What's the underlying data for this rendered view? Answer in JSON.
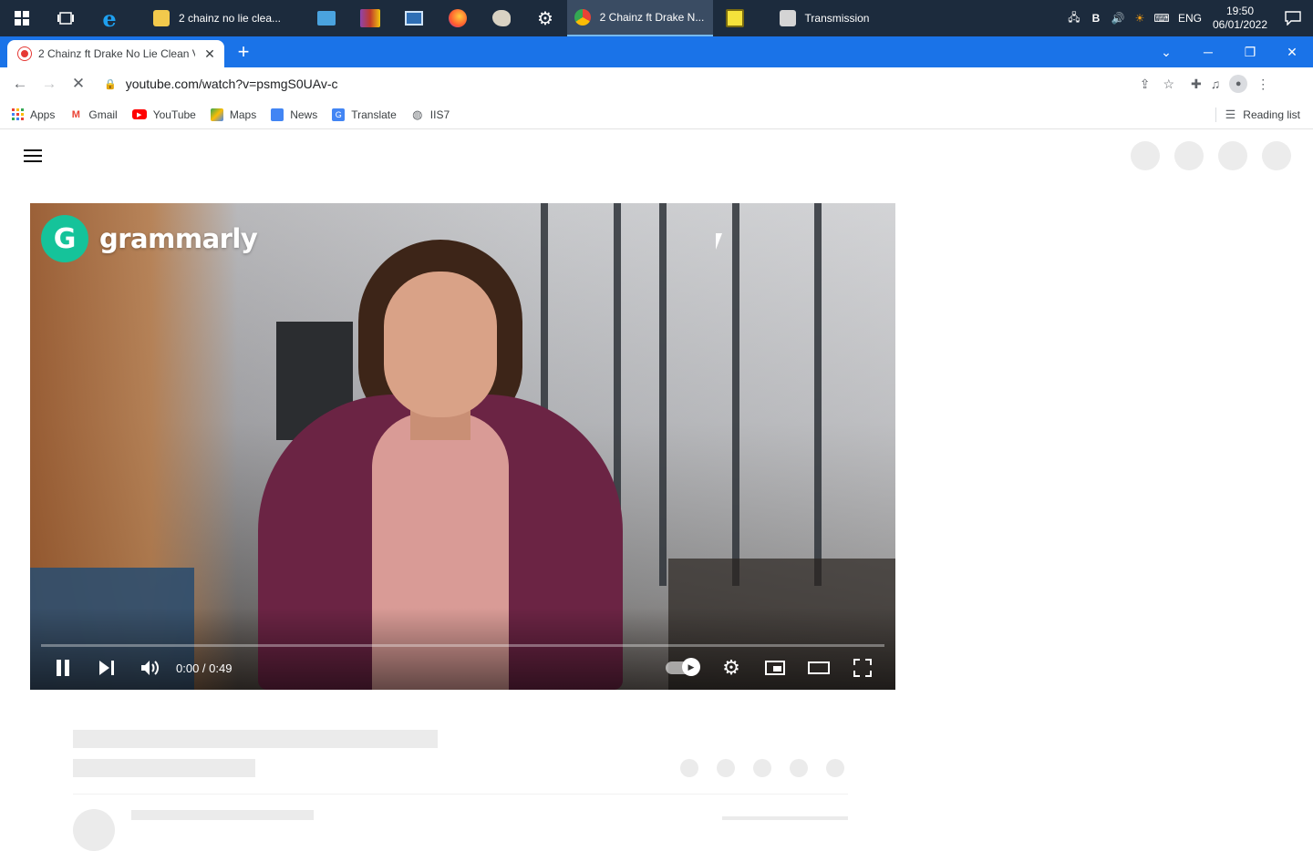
{
  "taskbar": {
    "apps": [
      {
        "label": "2 chainz no lie clea...",
        "icon": "folder-icon",
        "active": false
      },
      {
        "label": "2 Chainz ft Drake N...",
        "icon": "chrome-icon",
        "active": true
      },
      {
        "label": "Transmission",
        "icon": "transmission-icon",
        "active": false
      }
    ],
    "tray": {
      "keyboard_letter": "B",
      "language": "ENG",
      "time": "19:50",
      "date": "06/01/2022"
    }
  },
  "browser": {
    "tab": {
      "title": "2 Chainz ft Drake No Lie Clean V"
    },
    "url": "youtube.com/watch?v=psmgS0UAv-c",
    "bookmarks": [
      {
        "label": "Apps",
        "icon": "apps-grid-icon"
      },
      {
        "label": "Gmail",
        "icon": "gmail-icon"
      },
      {
        "label": "YouTube",
        "icon": "youtube-icon"
      },
      {
        "label": "Maps",
        "icon": "maps-icon"
      },
      {
        "label": "News",
        "icon": "news-icon"
      },
      {
        "label": "Translate",
        "icon": "translate-icon"
      },
      {
        "label": "IIS7",
        "icon": "globe-icon"
      }
    ],
    "reading_list": "Reading list"
  },
  "player": {
    "ad_brand": "grammarly",
    "ad_logo_letter": "G",
    "time_display": "0:00 / 0:49",
    "progress": 0,
    "autoplay": "on"
  },
  "colors": {
    "taskbar": "#1c2b3d",
    "tabstrip": "#1a73e8",
    "grammarly": "#15c39a"
  }
}
